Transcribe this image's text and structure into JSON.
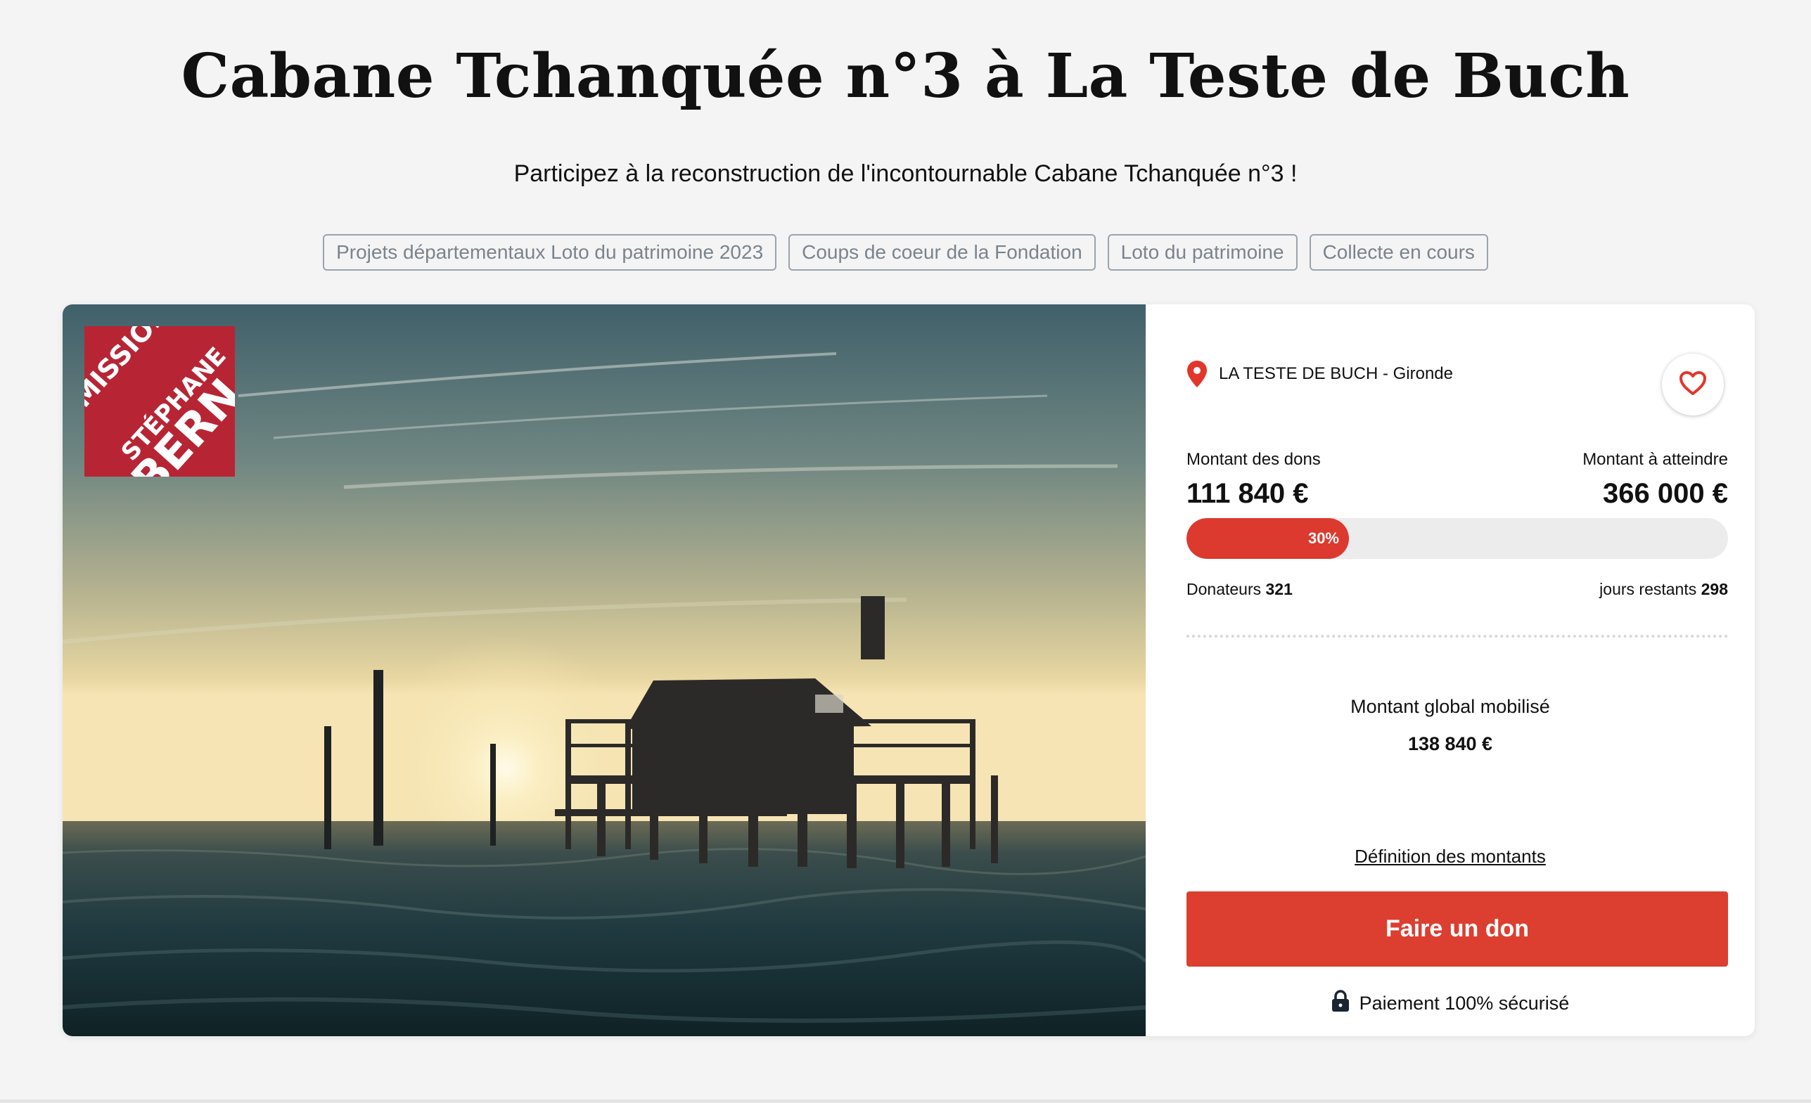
{
  "header": {
    "title": "Cabane Tchanquée n°3 à La Teste de Buch",
    "subtitle": "Participez à la reconstruction de l'incontournable Cabane Tchanquée n°3 !"
  },
  "tags": [
    "Projets départementaux Loto du patrimoine 2023",
    "Coups de coeur de la Fondation",
    "Loto du patrimoine",
    "Collecte en cours"
  ],
  "badge": {
    "line1": "MISSION",
    "line2": "STÉPHANE",
    "line3": "BERN",
    "color": "#b72535"
  },
  "panel": {
    "location": "LA TESTE DE BUCH - Gironde",
    "location_icon": "map-pin-icon",
    "favorite_icon": "heart-icon",
    "donations_label": "Montant des dons",
    "donations_value": "111 840 €",
    "goal_label": "Montant à atteindre",
    "goal_value": "366 000 €",
    "progress": {
      "percent": 30,
      "label": "30%"
    },
    "donors_label": "Donateurs",
    "donors_value": "321",
    "days_label": "jours restants",
    "days_value": "298",
    "global_label": "Montant global mobilisé",
    "global_value": "138 840 €",
    "definition_link": "Définition des montants",
    "donate_button": "Faire un don",
    "secure_icon": "lock-icon",
    "secure_text": "Paiement 100% sécurisé"
  },
  "colors": {
    "accent": "#dc3f30",
    "background": "#f4f4f4"
  }
}
